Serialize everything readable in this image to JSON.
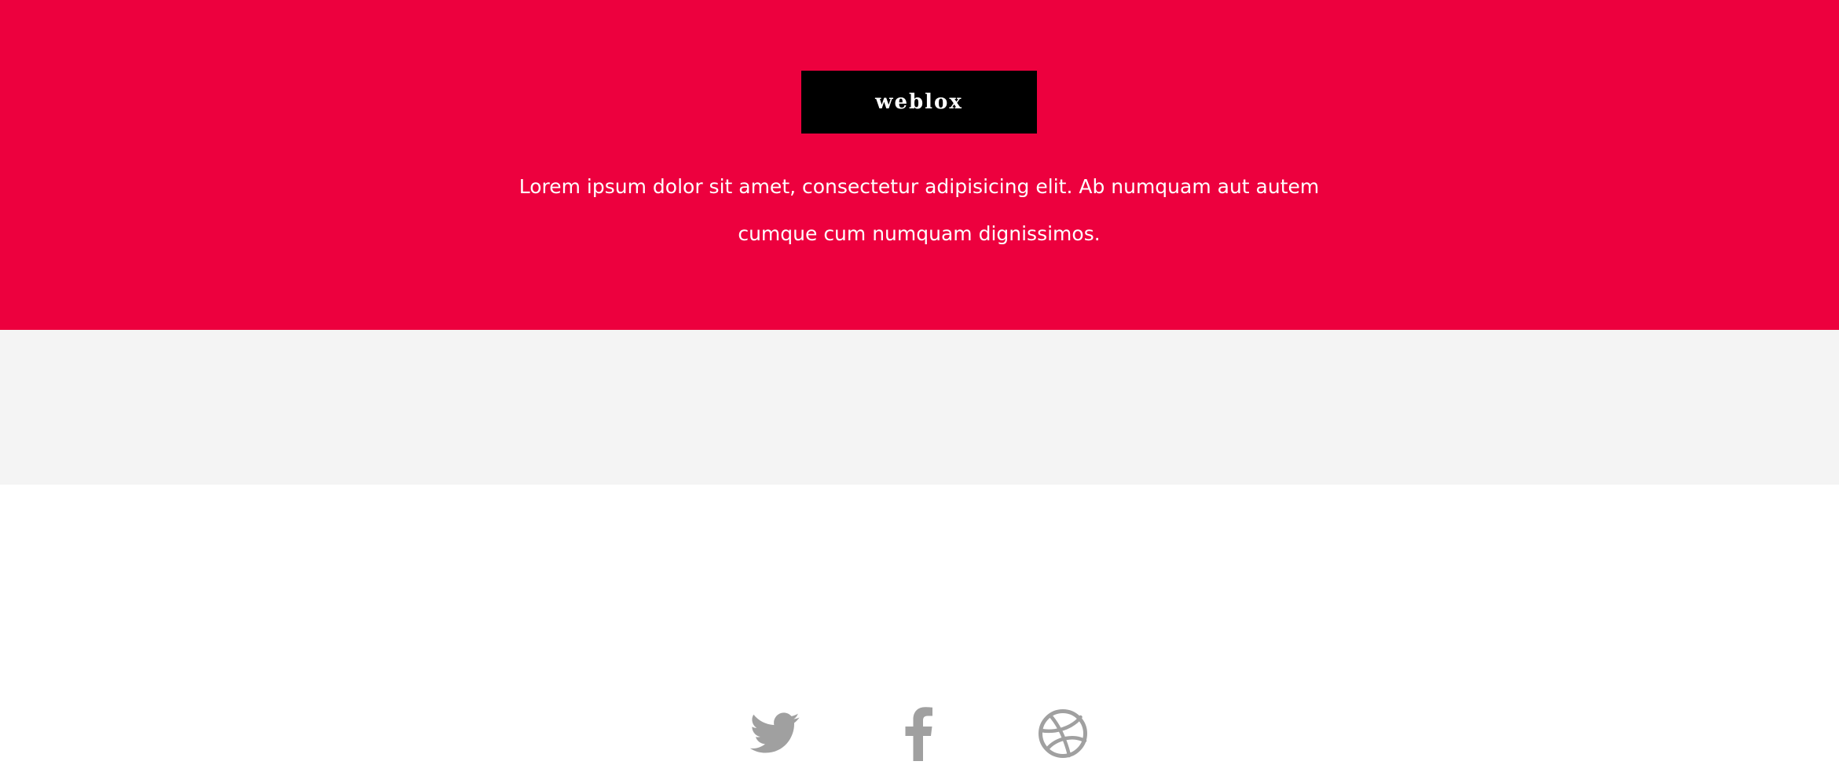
{
  "hero": {
    "background": "#ed003e",
    "logo": {
      "text": "weblox",
      "background": "#000000",
      "color": "#ffffff"
    },
    "tagline": "Lorem ipsum dolor sit amet, consectetur adipisicing elit. Ab numquam aut autem cumque cum numquam dignissimos.",
    "text_color": "#ffffff"
  },
  "footer": {
    "background": "#f4f4f4",
    "icon_color": "#a0a0a0",
    "social_links": [
      {
        "icon": "twitter-icon"
      },
      {
        "icon": "facebook-icon"
      },
      {
        "icon": "dribbble-icon"
      }
    ]
  }
}
